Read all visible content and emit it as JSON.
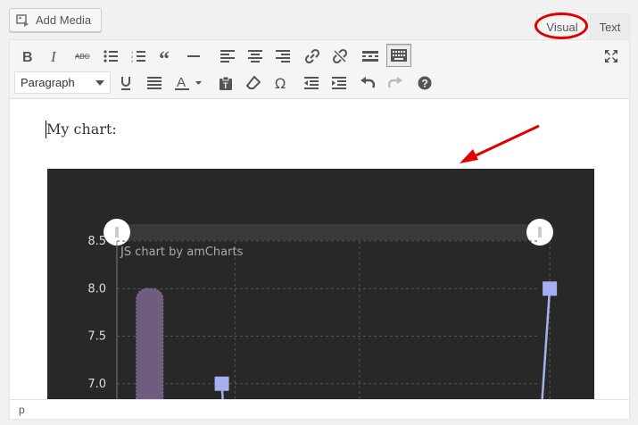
{
  "media_button": {
    "label": "Add Media"
  },
  "tabs": {
    "visual": "Visual",
    "text": "Text"
  },
  "toolbar": {
    "row1": [
      "bold-icon",
      "italic-icon",
      "strikethrough-icon",
      "bullet-list-icon",
      "numbered-list-icon",
      "blockquote-icon",
      "horizontal-line-icon",
      "align-left-icon",
      "align-center-icon",
      "align-right-icon",
      "link-icon",
      "unlink-icon",
      "read-more-icon",
      "toolbar-toggle-icon"
    ],
    "format_value": "Paragraph",
    "row2": [
      "underline-icon",
      "justify-icon",
      "text-color-icon",
      "paste-text-icon",
      "clear-formatting-icon",
      "special-character-icon",
      "outdent-icon",
      "indent-icon",
      "undo-icon",
      "redo-icon",
      "help-icon"
    ]
  },
  "content": {
    "paragraph": "My chart:"
  },
  "status": {
    "path": "p"
  },
  "colors": {
    "annotation": "#e00000",
    "chart_bg": "#282828",
    "series_line": "#a6b0f0",
    "column": "#6f5c7f"
  },
  "chart_data": {
    "type": "line",
    "credit": "JS chart by amCharts",
    "y_ticks": [
      "8.5",
      "8.0",
      "7.5",
      "7.0"
    ],
    "ylim": [
      6.8,
      8.5
    ],
    "series": [
      {
        "type": "column",
        "x": [
          0.25
        ],
        "values": [
          8.0
        ]
      },
      {
        "type": "line",
        "x": [
          0.8,
          3.3
        ],
        "values": [
          7.0,
          8.0
        ]
      }
    ],
    "grid": true,
    "scrollbar": true
  }
}
